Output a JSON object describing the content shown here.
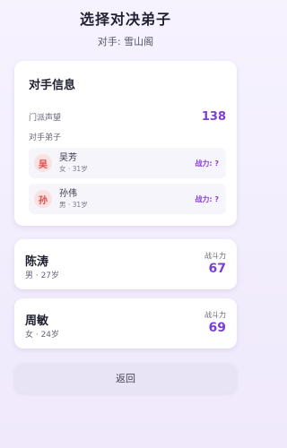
{
  "header": {
    "title": "选择对决弟子",
    "opponent_prefix": "对手: ",
    "opponent_name": "雪山阁"
  },
  "opponent_info": {
    "title": "对手信息",
    "fame_label": "门派声望",
    "fame_value": "138",
    "disciples_label": "对手弟子",
    "disciples": [
      {
        "avatar": "吴",
        "name": "吴芳",
        "meta": "女 · 31岁",
        "power": "战力: ?"
      },
      {
        "avatar": "孙",
        "name": "孙伟",
        "meta": "男 · 31岁",
        "power": "战力: ?"
      }
    ]
  },
  "my_disciples": [
    {
      "name": "陈涛",
      "meta": "男 · 27岁",
      "power_label": "战斗力",
      "power": "67"
    },
    {
      "name": "周敏",
      "meta": "女 · 24岁",
      "power_label": "战斗力",
      "power": "69"
    }
  ],
  "back_label": "返回",
  "colors": {
    "accent": "#7b3fd6",
    "avatar_bg": "#fde0e0",
    "avatar_text": "#d94a4a"
  }
}
